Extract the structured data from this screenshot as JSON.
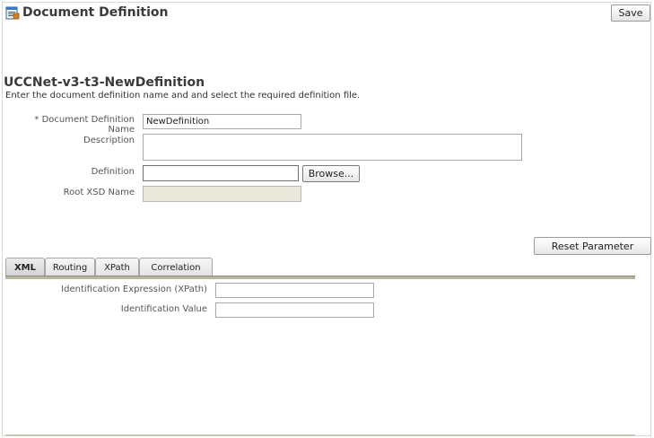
{
  "header": {
    "title": "Document Definition",
    "save_label": "Save"
  },
  "form": {
    "section_title": "UCCNet-v3-t3-NewDefinition",
    "instructions": "Enter the document definition name and and select the required definition file.",
    "name_label": "* Document Definition Name",
    "name_value": "NewDefinition",
    "description_label": "Description",
    "description_value": "",
    "definition_label": "Definition",
    "definition_value": "",
    "browse_label": "Browse...",
    "root_xsd_label": "Root XSD Name",
    "root_xsd_value": ""
  },
  "actions": {
    "reset_label": "Reset Parameter"
  },
  "tabs": [
    {
      "label": "XML",
      "active": true
    },
    {
      "label": "Routing",
      "active": false
    },
    {
      "label": "XPath",
      "active": false
    },
    {
      "label": "Correlation",
      "active": false
    }
  ],
  "xml_tab": {
    "id_expression_label": "Identification Expression (XPath)",
    "id_expression_value": "",
    "id_value_label": "Identification Value",
    "id_value_value": ""
  },
  "icons": {
    "title_icon": "document-definition-icon"
  }
}
